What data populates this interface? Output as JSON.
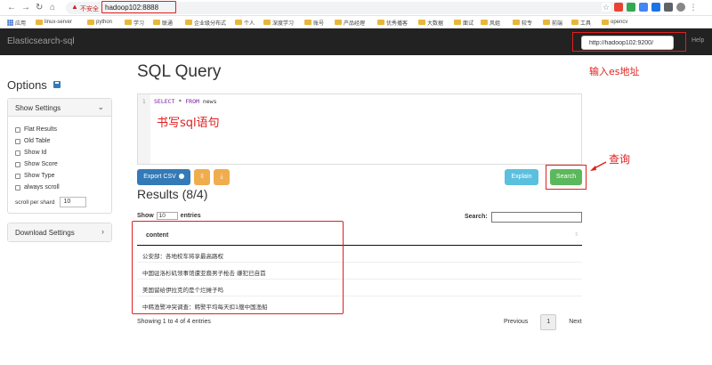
{
  "browser": {
    "insecure_label": "不安全",
    "url": "hadoop102:8888",
    "bookmarks": [
      "应用",
      "linux-server",
      "python",
      "学习",
      "联通",
      "企业级分布式",
      "个人",
      "深度学习",
      "账号",
      "产品经理",
      "优秀播客",
      "大数据",
      "面试",
      "风姐",
      "较专",
      "前端",
      "工具",
      "opencv"
    ]
  },
  "navbar": {
    "brand": "Elasticsearch-sql",
    "es_url": "http://hadoop102:9200/",
    "help": "Help"
  },
  "sidebar": {
    "title": "Options",
    "show_settings": "Show Settings",
    "checkboxes": [
      "Flat Results",
      "Old Table",
      "Show Id",
      "Show Score",
      "Show Type",
      "always scroll"
    ],
    "scroll_label": "scroll per shard",
    "scroll_value": "10",
    "download_settings": "Download Settings"
  },
  "main": {
    "title": "SQL Query",
    "line_number": "1",
    "sql_select": "SELECT",
    "sql_star": "*",
    "sql_from": "FROM",
    "sql_table": "news",
    "export_csv": "Export CSV",
    "explain": "Explain",
    "search": "Search",
    "results_title": "Results (8/4)",
    "show_label": "Show",
    "entries_value": "10",
    "entries_label": "entries",
    "search_label": "Search:",
    "column": "content",
    "rows": [
      "公安部：各地校车将享最高路权",
      "中国驻洛杉矶领事馆遭亚裔男子枪击 嫌犯已自首",
      "美国留给伊拉克的是个烂摊子吗",
      "中韩渔警冲突调查：韩警平均每天扣1艘中国渔船"
    ],
    "info": "Showing 1 to 4 of 4 entries",
    "previous": "Previous",
    "page": "1",
    "next": "Next"
  },
  "annotations": {
    "es_address": "输入es地址",
    "write_sql": "书写sql语句",
    "query": "查询"
  },
  "colors": {
    "navbar": "#222222",
    "primary": "#337ab7",
    "warning": "#f0ad4e",
    "info": "#5bc0de",
    "success": "#5cb85c",
    "annotation": "#e02020"
  }
}
